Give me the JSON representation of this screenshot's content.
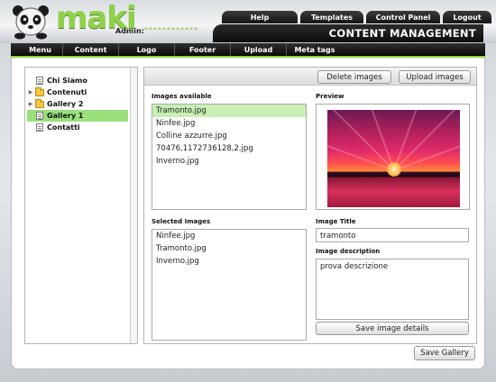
{
  "brand": {
    "logo_text": "maki"
  },
  "header": {
    "admin_label": "Admin:",
    "admin_value": "************",
    "title": "CONTENT MANAGEMENT",
    "top_tabs": [
      {
        "label": "Help"
      },
      {
        "label": "Templates"
      },
      {
        "label": "Control Panel"
      },
      {
        "label": "Logout"
      }
    ]
  },
  "menu": [
    {
      "label": "Menu"
    },
    {
      "label": "Content"
    },
    {
      "label": "Logo"
    },
    {
      "label": "Footer"
    },
    {
      "label": "Upload"
    },
    {
      "label": "Meta tags"
    }
  ],
  "tree": [
    {
      "label": "Chi Siamo",
      "icon": "document-icon",
      "expandable": false,
      "selected": false
    },
    {
      "label": "Contenuti",
      "icon": "folder-icon",
      "expandable": true,
      "selected": false
    },
    {
      "label": "Gallery 2",
      "icon": "folder-icon",
      "expandable": true,
      "selected": false
    },
    {
      "label": "Gallery 1",
      "icon": "document-icon",
      "expandable": false,
      "selected": true
    },
    {
      "label": "Contatti",
      "icon": "document-icon",
      "expandable": false,
      "selected": false
    }
  ],
  "toolbar": {
    "delete_label": "Delete images",
    "upload_label": "Upload images"
  },
  "available": {
    "label": "Images available",
    "items": [
      "Tramonto.jpg",
      "Ninfee.jpg",
      "Colline azzurre.jpg",
      "70476,1172736128,2.jpg",
      "Inverno.jpg"
    ],
    "selected_index": 0
  },
  "preview": {
    "label": "Preview"
  },
  "selected_images": {
    "label": "Selected Images",
    "items": [
      "Ninfee.jpg",
      "Tramonto.jpg",
      "Inverno.jpg"
    ]
  },
  "image_title": {
    "label": "Image Title",
    "value": "tramonto"
  },
  "image_description": {
    "label": "Image description",
    "value": "prova descrizione"
  },
  "save_details_label": "Save image details",
  "save_gallery_label": "Save Gallery",
  "colors": {
    "accent_green": "#8cd43c",
    "selection_green": "#99e07a",
    "header_dark": "#151515"
  }
}
